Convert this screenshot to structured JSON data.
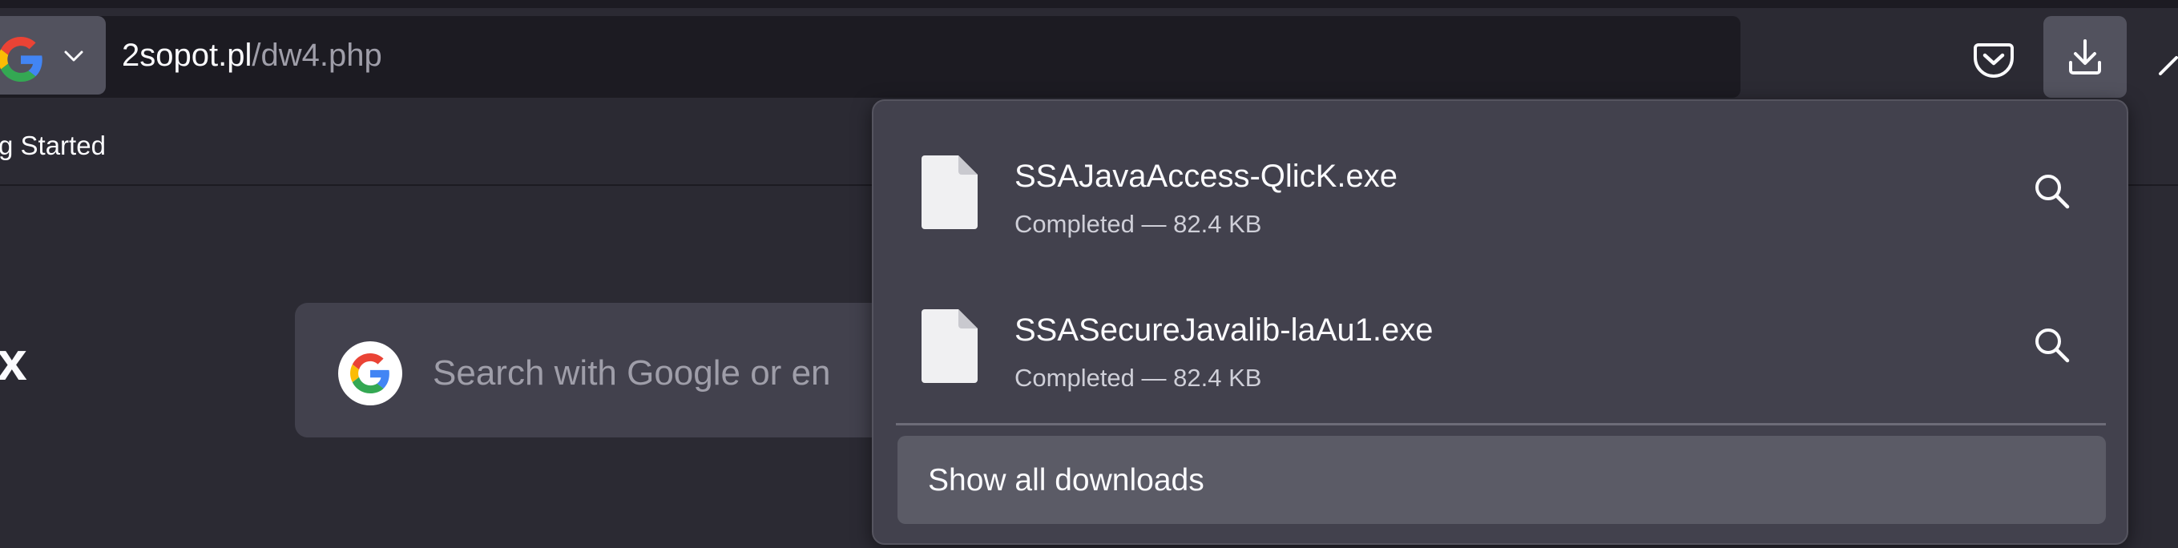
{
  "browser": {
    "url_domain": "2sopot.pl",
    "url_path": "/dw4.php",
    "search_engine_icon": "google-g-icon",
    "colors": {
      "toolbar_bg": "#2b2a33",
      "urlbar_bg": "#1c1b22",
      "panel_bg": "#42414d",
      "button_active_bg": "#52525e",
      "google_blue": "#4285f4",
      "google_red": "#ea4335",
      "google_yellow": "#fbbc05",
      "google_green": "#34a853"
    }
  },
  "bookmarks_bar": {
    "items": [
      {
        "label": "g Started"
      }
    ]
  },
  "new_tab": {
    "brand_fragment": "x",
    "search_placeholder": "Search with Google or en"
  },
  "downloads_panel": {
    "items": [
      {
        "filename": "SSAJavaAccess-QlicK.exe",
        "status": "Completed — 82.4 KB"
      },
      {
        "filename": "SSASecureJavalib-laAu1.exe",
        "status": "Completed — 82.4 KB"
      }
    ],
    "show_all_label": "Show all downloads"
  }
}
